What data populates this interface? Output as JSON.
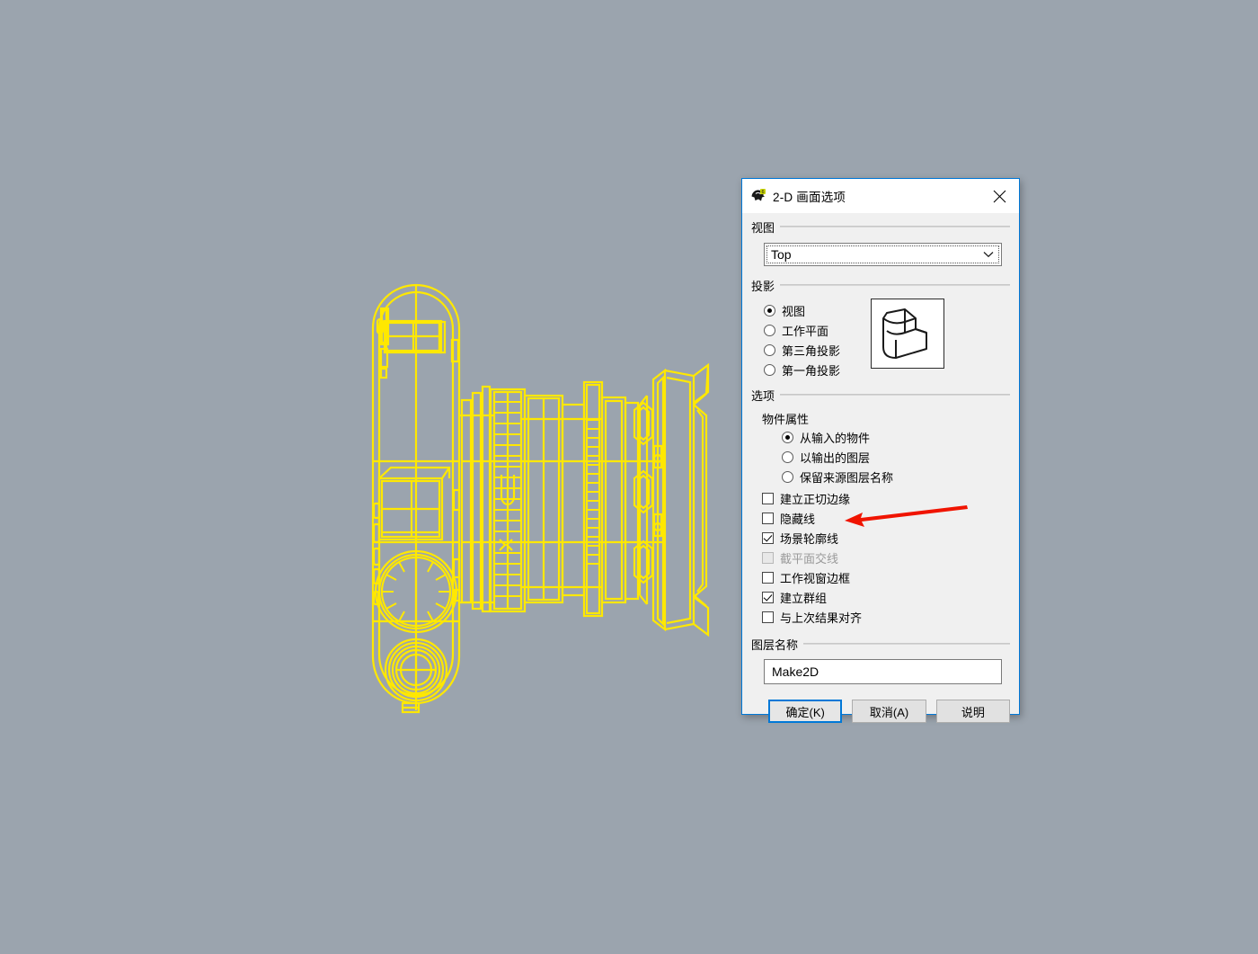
{
  "canvas": {
    "background_color": "#9ba4ae",
    "wireframe_color": "#ffe800",
    "wireframe_name": "camera-lens-assembly-2d-wireframe"
  },
  "dialog": {
    "title": "2-D 画面选项",
    "icon_name": "rhino-app-icon",
    "close_label": "✕",
    "view_group": {
      "label": "视图",
      "combo": {
        "value": "Top",
        "arrow_icon": "chevron-down-icon"
      }
    },
    "projection_group": {
      "label": "投影",
      "selected_index": 0,
      "radios": [
        {
          "label": "视图",
          "checked": true
        },
        {
          "label": "工作平面",
          "checked": false
        },
        {
          "label": "第三角投影",
          "checked": false
        },
        {
          "label": "第一角投影",
          "checked": false
        }
      ],
      "preview_name": "isometric-solid-preview"
    },
    "options_group": {
      "label": "选项",
      "object_properties_label": "物件属性",
      "object_property_radios": [
        {
          "label": "从输入的物件",
          "checked": true
        },
        {
          "label": "以输出的图层",
          "checked": false
        },
        {
          "label": "保留来源图层名称",
          "checked": false
        }
      ],
      "checkboxes": [
        {
          "label": "建立正切边缘",
          "checked": false,
          "disabled": false
        },
        {
          "label": "隐藏线",
          "checked": false,
          "disabled": false
        },
        {
          "label": "场景轮廓线",
          "checked": true,
          "disabled": false
        },
        {
          "label": "截平面交线",
          "checked": false,
          "disabled": true
        },
        {
          "label": "工作视窗边框",
          "checked": false,
          "disabled": false
        },
        {
          "label": "建立群组",
          "checked": true,
          "disabled": false
        },
        {
          "label": "与上次结果对齐",
          "checked": false,
          "disabled": false
        }
      ]
    },
    "layer_group": {
      "label": "图层名称",
      "value": "Make2D"
    },
    "buttons": [
      {
        "label": "确定(K)",
        "accel": "K",
        "default": true
      },
      {
        "label": "取消(A)",
        "accel": "A",
        "default": false
      },
      {
        "label": "说明",
        "accel": "",
        "default": false
      }
    ]
  },
  "annotation": {
    "name": "red-arrow-pointer",
    "color": "#f01400",
    "points_to": "场景轮廓线"
  }
}
